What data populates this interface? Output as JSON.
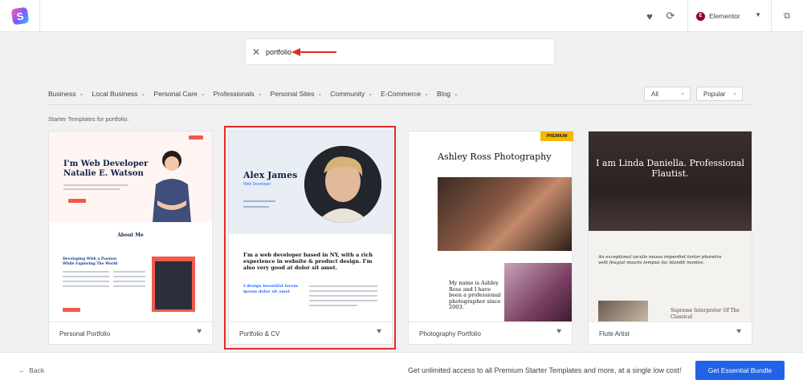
{
  "header": {
    "logo_letter": "S",
    "builder_label": "Elementor",
    "builder_icon_letter": "E",
    "icons": [
      "heart-icon",
      "sync-icon",
      "chevron-down-icon",
      "external-link-icon"
    ]
  },
  "search": {
    "value": "portfolio"
  },
  "filters": {
    "categories": [
      "Business",
      "Local Business",
      "Personal Care",
      "Professionals",
      "Personal Sites",
      "Community",
      "E-Commerce",
      "Blog"
    ],
    "type_select": "All",
    "sort_select": "Popular"
  },
  "results_label": "Starter Templates for portfolio:",
  "cards": [
    {
      "name": "Personal Portfolio",
      "hero_title": "I'm Web Developer Natalie E. Watson",
      "section_title": "About Me",
      "section_text": "Developing With a Passion While Exploring The World"
    },
    {
      "name": "Portfolio & CV",
      "hero_title": "Alex James",
      "hero_subtitle": "Web Developer",
      "body_text": "I'm a web developer based in NY, with a rich experience in website & product design. I'm also very good at dolor sit amet.",
      "blue_text": "I design beautiful lorem ipsum dolor sit amet"
    },
    {
      "name": "Photography Portfolio",
      "badge": "PREMIUM",
      "hero_title": "Ashley Ross Photography",
      "body_text": "My name is Ashley Ross and I have been a professional photographer since 2003."
    },
    {
      "name": "Flute Artist",
      "hero_title": "I am Linda Daniella. Professional Flautist.",
      "quote": "An exceptional iaculis massa imperdiet tortor pharetra velit feugiat mauris tempus fac blandit montes.",
      "subheading": "Supreme Interpreter Of The Classical"
    }
  ],
  "footer": {
    "back_label": "Back",
    "promo_text": "Get unlimited access to all Premium Starter Templates and more, at a single low cost!",
    "cta_label": "Get Essential Bundle"
  },
  "colors": {
    "accent": "#2163e6",
    "highlight": "#e22b2b",
    "premium": "#f5b800"
  }
}
